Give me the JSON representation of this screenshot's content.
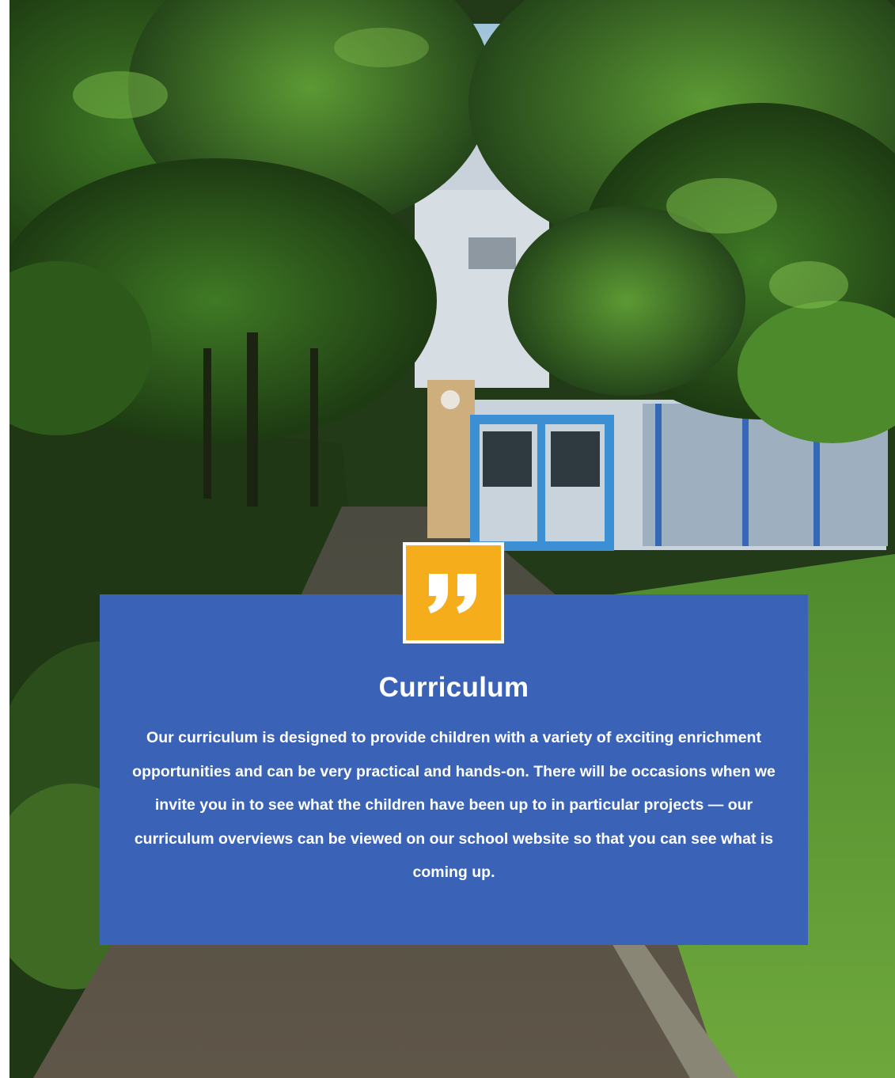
{
  "card": {
    "title": "Curriculum",
    "body": "Our curriculum is designed to provide children with a variety of exciting enrichment opportunities and can be very practical and hands-on. There will be occasions when we invite you in to see what the children have been up to in particular projects — our curriculum overviews can be viewed on our school website so that you can see what is coming up."
  },
  "quote_badge": {
    "icon": "quote-icon"
  },
  "colors": {
    "card_blue": "#3a63b8",
    "badge_orange": "#f5ad1c",
    "text_white": "#ffffff"
  },
  "photo": {
    "icon": "school-building-photo"
  }
}
